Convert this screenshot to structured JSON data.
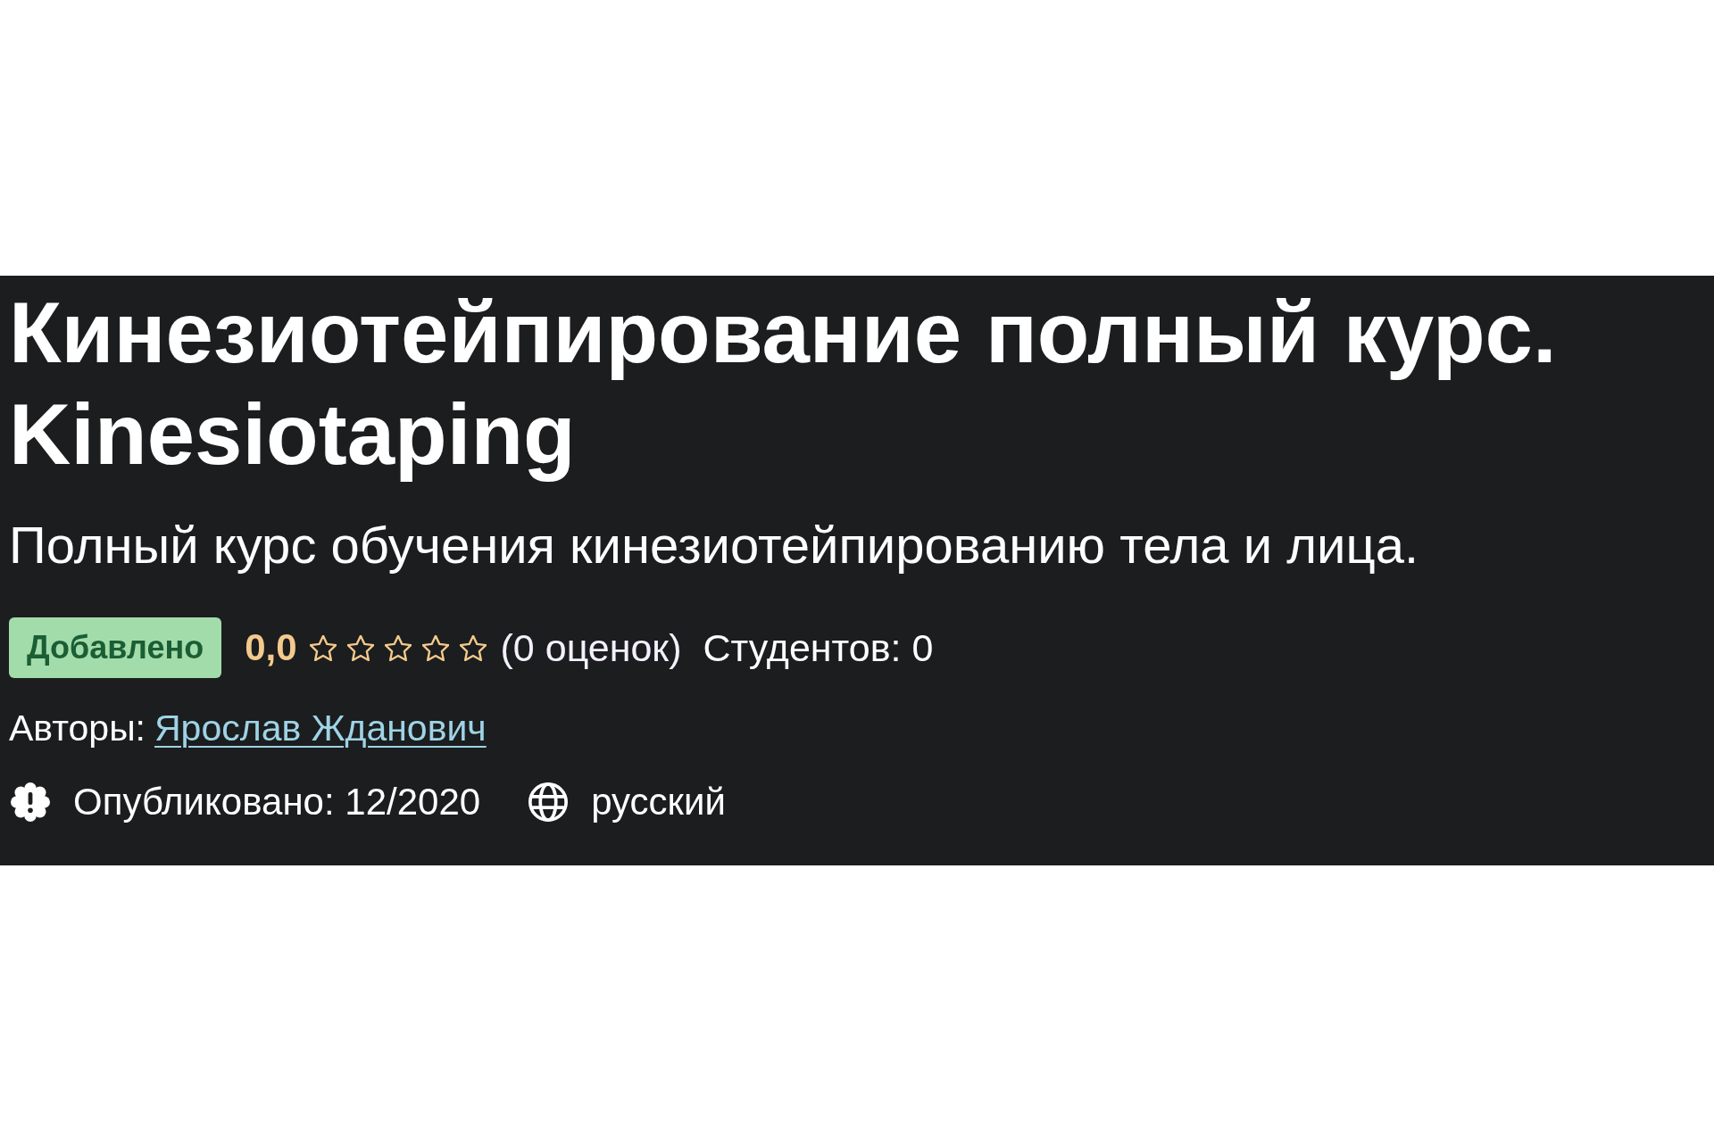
{
  "course": {
    "title": "Кинезиотейпирование полный курс. Kinesiotaping",
    "subtitle": "Полный курс обучения кинезиотейпированию тела и лица.",
    "badge": "Добавлено",
    "rating": {
      "value": "0,0",
      "stars": 0,
      "count": "(0 оценок)"
    },
    "students": "Студентов: 0",
    "authors": {
      "label": "Авторы:",
      "names": [
        "Ярослав Жданович"
      ]
    },
    "meta": [
      {
        "kind": "published",
        "text": "Опубликовано: 12/2020"
      },
      {
        "kind": "language",
        "text": "русский"
      }
    ]
  }
}
